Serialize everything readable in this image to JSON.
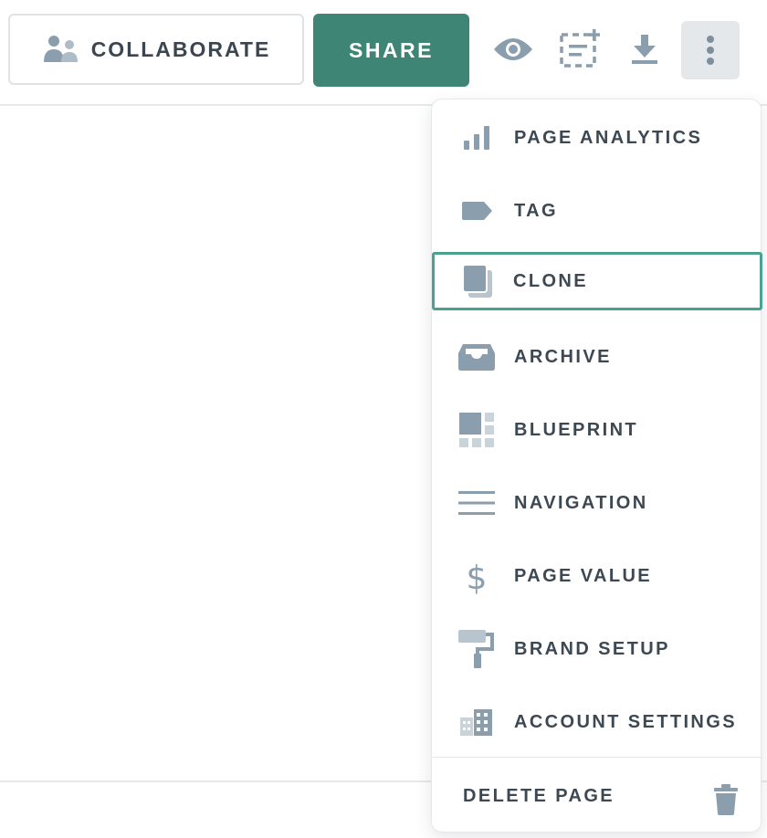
{
  "toolbar": {
    "collaborate_label": "COLLABORATE",
    "share_label": "SHARE",
    "icons": [
      "people-icon",
      "eye-icon",
      "add-section-icon",
      "download-icon",
      "more-vertical-icon"
    ]
  },
  "menu": {
    "items": [
      {
        "label": "PAGE ANALYTICS",
        "icon": "bar-chart-icon"
      },
      {
        "label": "TAG",
        "icon": "tag-icon"
      },
      {
        "label": "CLONE",
        "icon": "clone-icon",
        "focused": true
      },
      {
        "label": "ARCHIVE",
        "icon": "archive-icon"
      },
      {
        "label": "BLUEPRINT",
        "icon": "blueprint-icon"
      },
      {
        "label": "NAVIGATION",
        "icon": "menu-lines-icon"
      },
      {
        "label": "PAGE VALUE",
        "icon": "dollar-icon"
      },
      {
        "label": "BRAND SETUP",
        "icon": "paint-roller-icon"
      },
      {
        "label": "ACCOUNT SETTINGS",
        "icon": "building-icon"
      }
    ],
    "delete_label": "DELETE PAGE"
  },
  "colors": {
    "accent": "#3e8575",
    "focus_border": "#4aa191",
    "icon": "#8a9eae",
    "text": "#3d4852"
  }
}
